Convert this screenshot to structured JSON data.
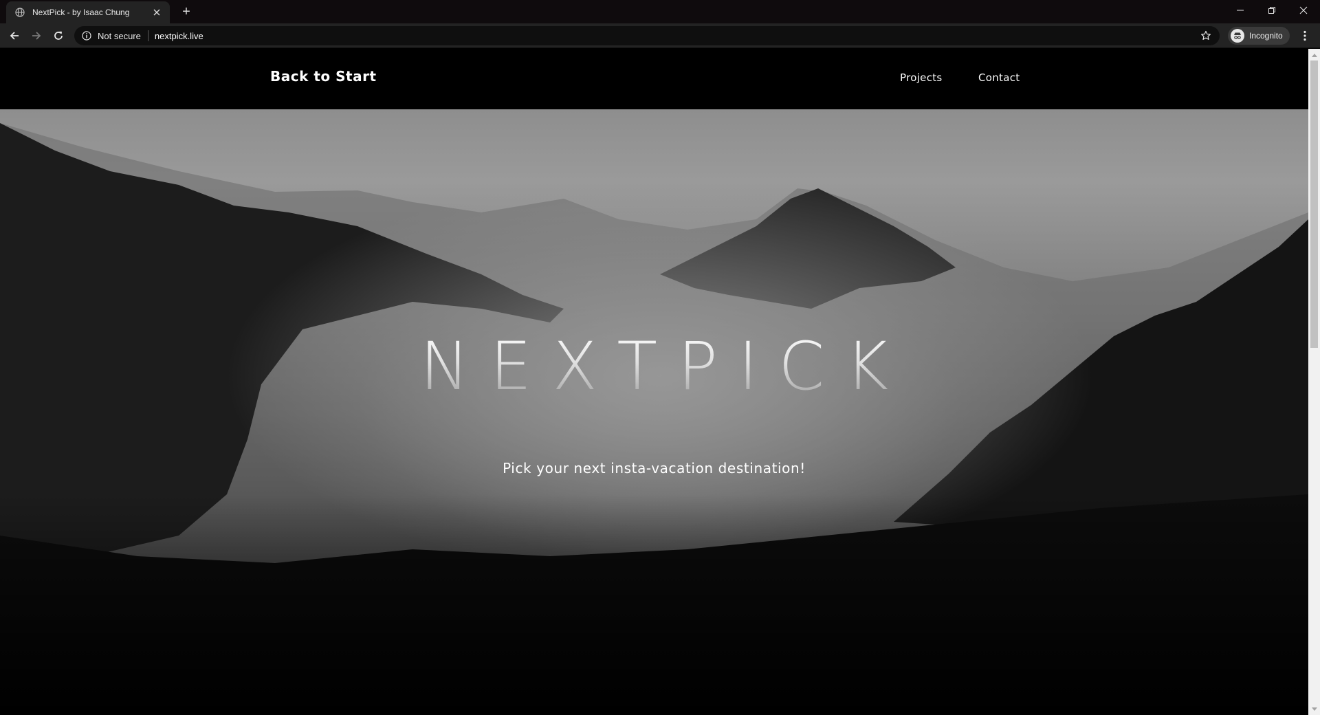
{
  "browser": {
    "tab": {
      "title": "NextPick - by Isaac Chung",
      "favicon": "globe-icon"
    },
    "new_tab_symbol": "+",
    "address": {
      "security_label": "Not secure",
      "url": "nextpick.live"
    },
    "profile": {
      "label": "Incognito"
    }
  },
  "site": {
    "brand": "Back to Start",
    "nav": [
      {
        "label": "Projects"
      },
      {
        "label": "Contact"
      }
    ],
    "hero": {
      "title": "NEXTPICK",
      "subtitle": "Pick your next insta-vacation destination!"
    }
  },
  "colors": {
    "nav_background": "#000000",
    "chrome_tabbar": "#0f0b0d",
    "chrome_toolbar": "#232323"
  }
}
